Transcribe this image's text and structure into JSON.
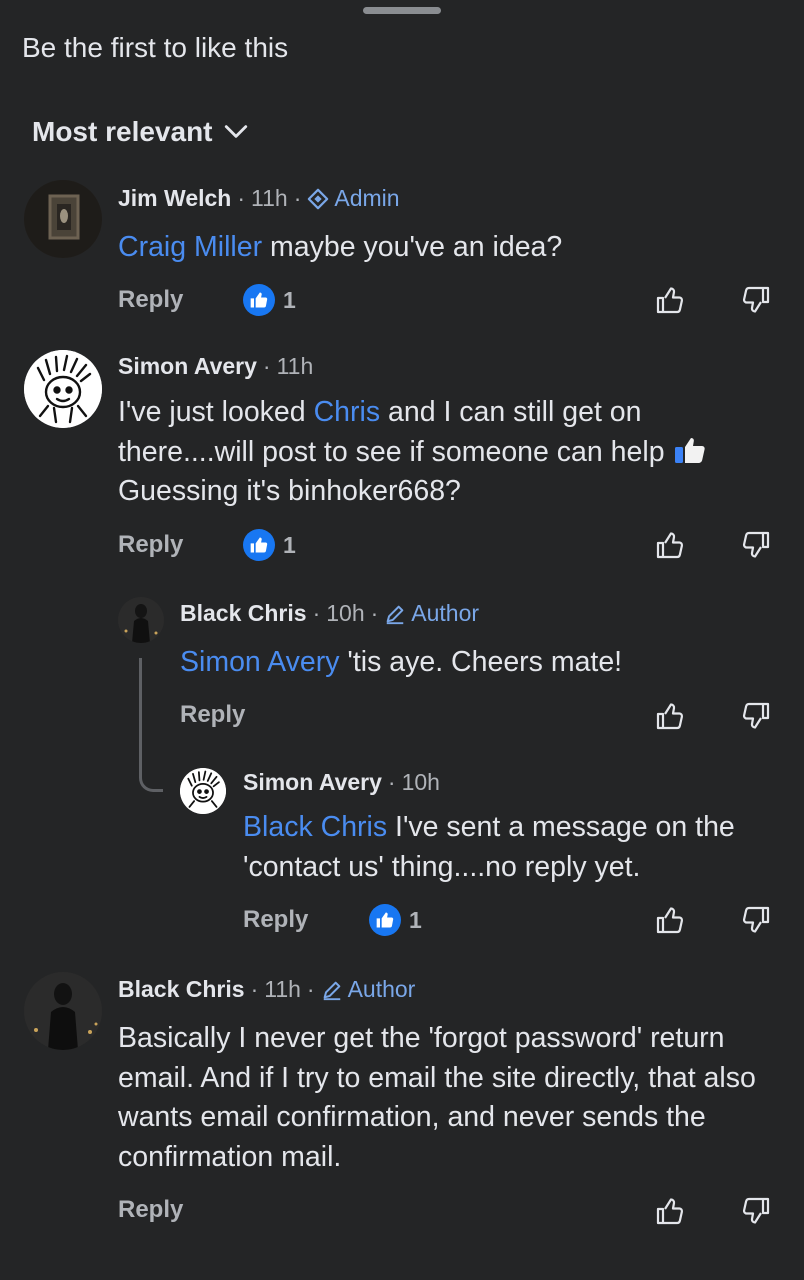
{
  "header": {
    "likes_text": "Be the first to like this",
    "sort_label": "Most relevant"
  },
  "colors": {
    "background": "#242526",
    "mention": "#4a8cf0",
    "badge": "#7aa7e8",
    "like": "#1877f2"
  },
  "comments": [
    {
      "name": "Jim Welch",
      "time": "11h",
      "badge": "Admin",
      "badge_icon": "admin-diamond-icon",
      "mention": "Craig Miller",
      "text": " maybe you've an idea?",
      "reply_label": "Reply",
      "like_count": "1"
    },
    {
      "name": "Simon Avery",
      "time": "11h",
      "text_before": "I've just looked ",
      "mention": "Chris",
      "text_after": " and I can still get on there....will post to see if someone can help",
      "text_line3": "Guessing it's binhoker668?",
      "reply_label": "Reply",
      "like_count": "1"
    },
    {
      "name": "Black Chris",
      "time": "10h",
      "badge": "Author",
      "badge_icon": "pencil-icon",
      "mention": "Simon Avery",
      "text": " 'tis aye.  Cheers mate!",
      "reply_label": "Reply"
    },
    {
      "name": "Simon Avery",
      "time": "10h",
      "mention": "Black Chris",
      "text": " I've sent a message on the 'contact us' thing....no reply yet.",
      "reply_label": "Reply",
      "like_count": "1"
    },
    {
      "name": "Black Chris",
      "time": "11h",
      "badge": "Author",
      "badge_icon": "pencil-icon",
      "text": "Basically I never get the 'forgot password' return email. And if I try to email the site directly, that also wants email confirmation, and never sends the confirmation mail.",
      "reply_label": "Reply"
    }
  ]
}
